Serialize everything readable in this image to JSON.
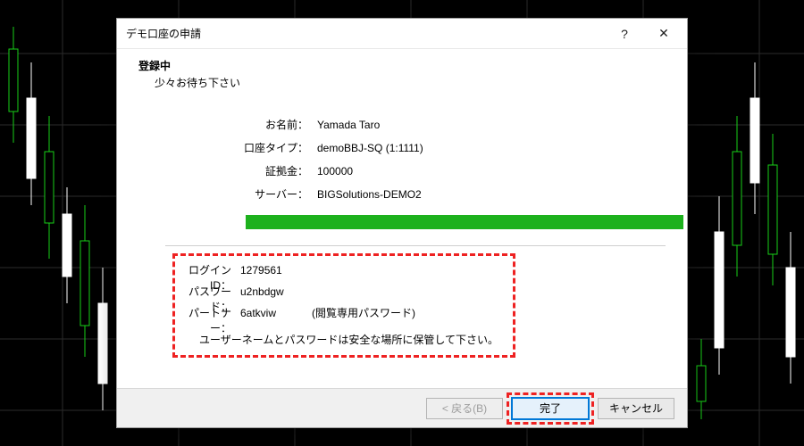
{
  "dialog": {
    "title": "デモ口座の申請",
    "help_label": "?",
    "close_label": "✕",
    "status_title": "登録中",
    "status_sub": "少々お待ち下さい",
    "rows": {
      "name_label": "お名前：",
      "name_value": "Yamada Taro",
      "type_label": "口座タイプ：",
      "type_value": "demoBBJ-SQ (1:1111)",
      "deposit_label": "証拠金：",
      "deposit_value": "100000",
      "server_label": "サーバー：",
      "server_value": "BIGSolutions-DEMO2"
    },
    "progress": {
      "percent": 100
    },
    "credentials": {
      "login_label": "ログインID：",
      "login_value": "1279561",
      "password_label": "パスワード：",
      "password_value": "u2nbdgw",
      "partner_label": "パートナー：",
      "partner_value": "6atkviw",
      "partner_note": "(閲覧専用パスワード)",
      "warning": "ユーザーネームとパスワードは安全な場所に保管して下さい。"
    },
    "buttons": {
      "back": "< 戻る(B)",
      "finish": "完了",
      "cancel": "キャンセル"
    }
  }
}
